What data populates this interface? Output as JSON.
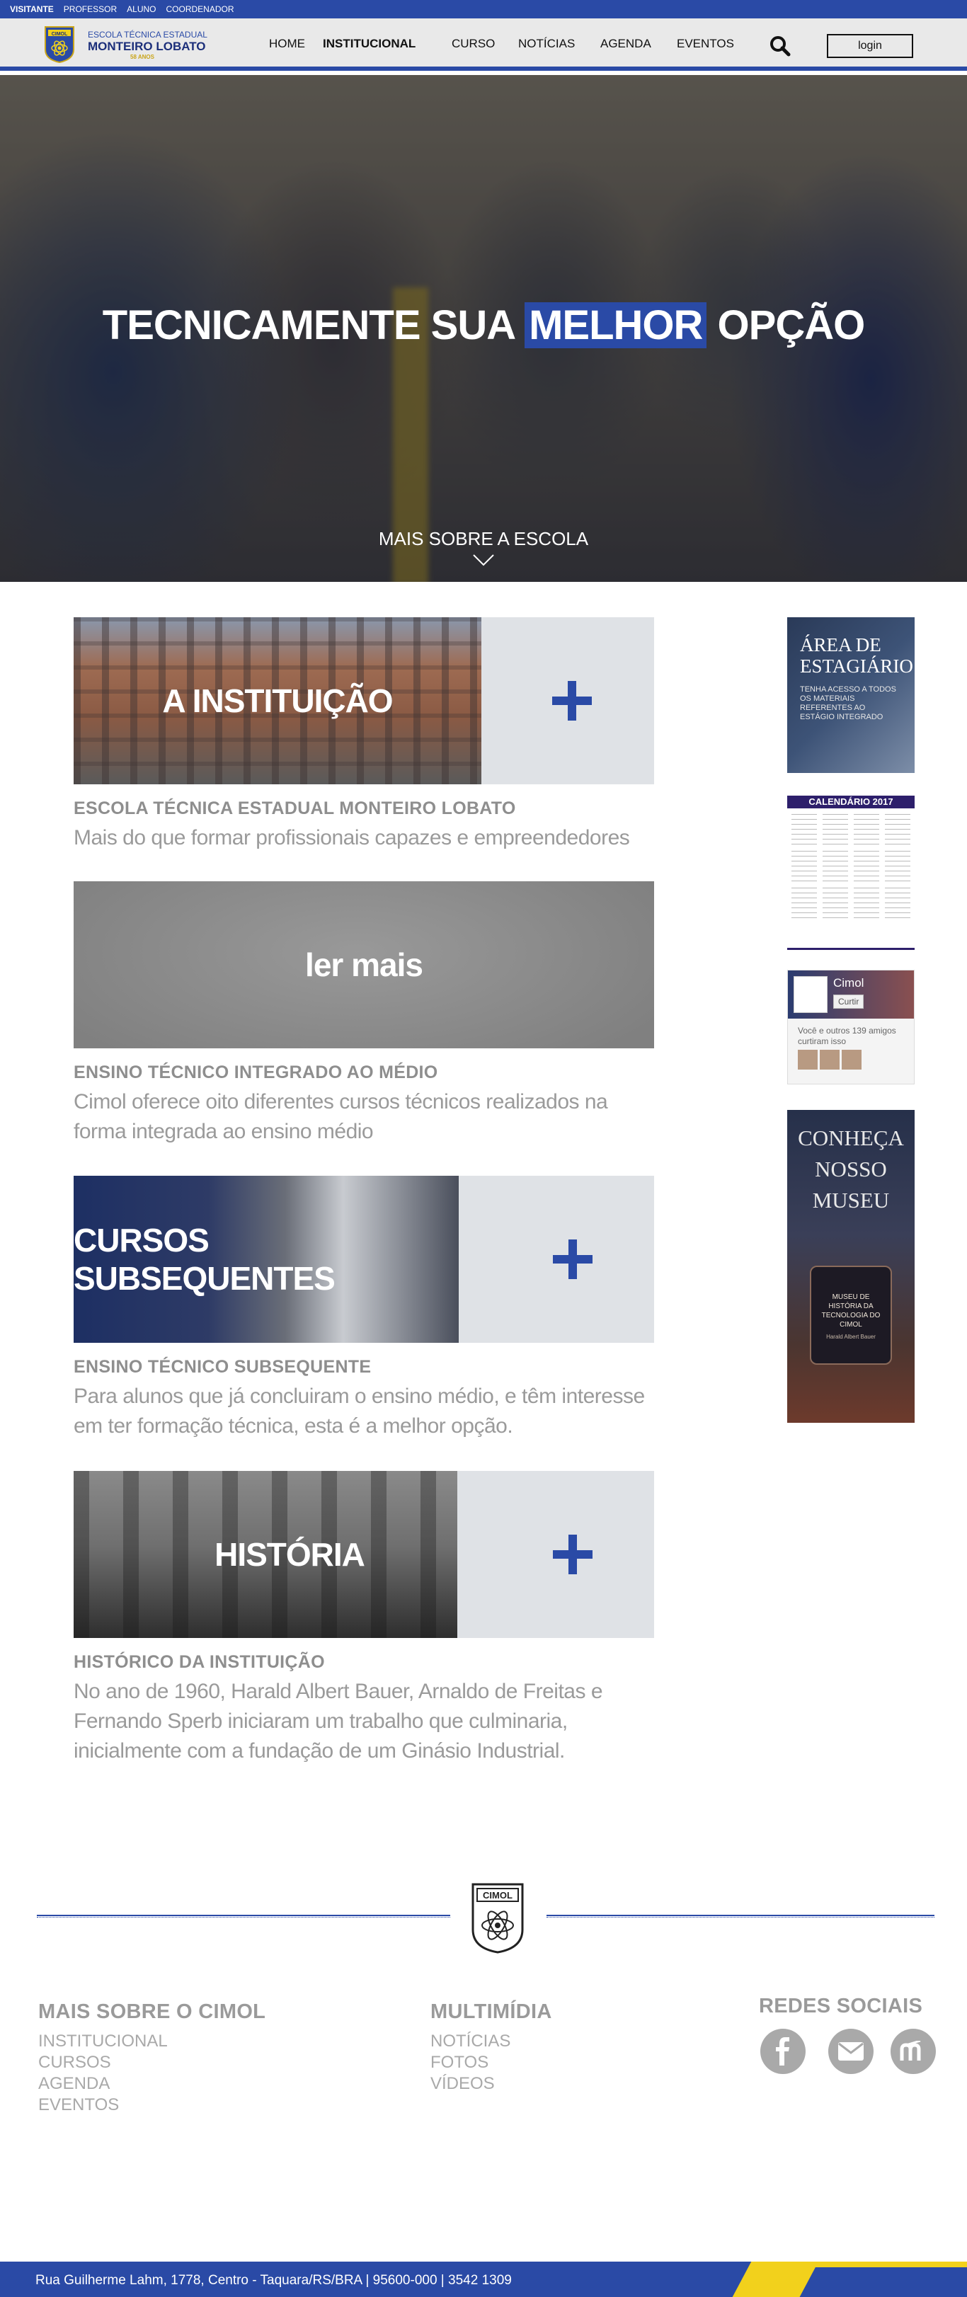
{
  "rolebar": {
    "items": [
      "VISITANTE",
      "PROFESSOR",
      "ALUNO",
      "COORDENADOR"
    ]
  },
  "header": {
    "logo_line1": "ESCOLA TÉCNICA ESTADUAL",
    "logo_line2": "MONTEIRO LOBATO",
    "logo_line3": "58 ANOS",
    "logo_badge": "CIMOL",
    "menu": [
      "HOME",
      "INSTITUCIONAL",
      "CURSO",
      "NOTÍCIAS",
      "AGENDA",
      "EVENTOS"
    ],
    "active_menu": "INSTITUCIONAL",
    "login_label": "login",
    "search_icon": "search-icon"
  },
  "hero": {
    "title_before": "TECNICAMENTE SUA ",
    "title_highlight": "MELHOR",
    "title_after": " OPÇÃO",
    "more_label": "MAIS SOBRE A ESCOLA"
  },
  "blocks": [
    {
      "caption": "A INSTITUIÇÃO",
      "title": "ESCOLA TÉCNICA ESTADUAL MONTEIRO LOBATO",
      "text": "Mais do que formar profissionais capazes e empreendedores"
    },
    {
      "caption": "ler mais",
      "title": "ENSINO TÉCNICO INTEGRADO AO MÉDIO",
      "text": "Cimol oferece oito diferentes cursos técnicos realizados na forma integrada ao ensino médio"
    },
    {
      "caption": "CURSOS SUBSEQUENTES",
      "title": "ENSINO TÉCNICO SUBSEQUENTE",
      "text": "Para alunos que já concluiram o ensino médio, e têm interesse em ter formação técnica, esta é a melhor opção."
    },
    {
      "caption": "HISTÓRIA",
      "title": "HISTÓRICO DA INSTITUIÇÃO",
      "text": "No ano de 1960, Harald Albert Bauer, Arnaldo de Freitas e Fernando Sperb iniciaram um trabalho que culminaria, inicialmente com a fundação de um Ginásio Industrial."
    }
  ],
  "sidebar": {
    "estagio_title": "ÁREA DE ESTAGIÁRIO",
    "estagio_text": "TENHA ACESSO A TODOS OS MATERIAIS REFERENTES AO ESTÁGIO INTEGRADO",
    "calendar_title": "CALENDÁRIO 2017",
    "fb_name": "Cimol",
    "fb_like": "Curtir",
    "fb_text": "Você e outros 139 amigos curtiram isso",
    "museum_title": "CONHEÇA NOSSO MUSEU",
    "museum_badge": "MUSEU DE HISTÓRIA DA TECNOLOGIA DO CIMOL",
    "museum_sub": "Harald Albert Bauer"
  },
  "footer": {
    "logo_label": "CIMOL",
    "col1_title": "MAIS SOBRE O CIMOL",
    "col1_links": [
      "INSTITUCIONAL",
      "CURSOS",
      "AGENDA",
      "EVENTOS"
    ],
    "col2_title": "MULTIMÍDIA",
    "col2_links": [
      "NOTÍCIAS",
      "FOTOS",
      "VÍDEOS"
    ],
    "col3_title": "REDES SOCIAIS",
    "social_icons": [
      "facebook-icon",
      "mail-icon",
      "moodle-icon"
    ],
    "address": "Rua Guilherme Lahm, 1778, Centro - Taquara/RS/BRA | 95600-000 | 3542 1309"
  },
  "colors": {
    "brand_blue": "#2a4aa6",
    "brand_yellow": "#f2d11c",
    "muted_text": "#9a9a9a"
  }
}
